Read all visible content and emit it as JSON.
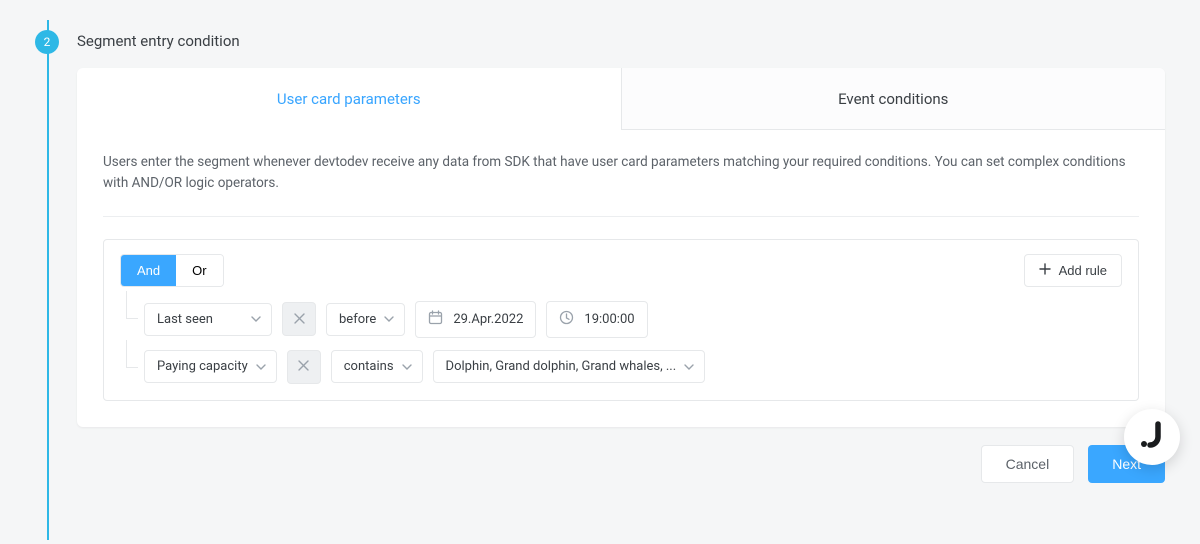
{
  "step": {
    "number": "2",
    "title": "Segment entry condition"
  },
  "tabs": {
    "user_card": "User card parameters",
    "event_conditions": "Event conditions"
  },
  "description": "Users enter the segment whenever devtodev receive any data from SDK that have user card parameters matching your required conditions. You can set complex conditions with AND/OR logic operators.",
  "logic": {
    "and": "And",
    "or": "Or"
  },
  "add_rule": "Add rule",
  "rules": [
    {
      "field": "Last seen",
      "operator": "before",
      "date": "29.Apr.2022",
      "time": "19:00:00"
    },
    {
      "field": "Paying capacity",
      "operator": "contains",
      "values": "Dolphin, Grand dolphin, Grand whales, ..."
    }
  ],
  "footer": {
    "cancel": "Cancel",
    "next": "Next"
  }
}
